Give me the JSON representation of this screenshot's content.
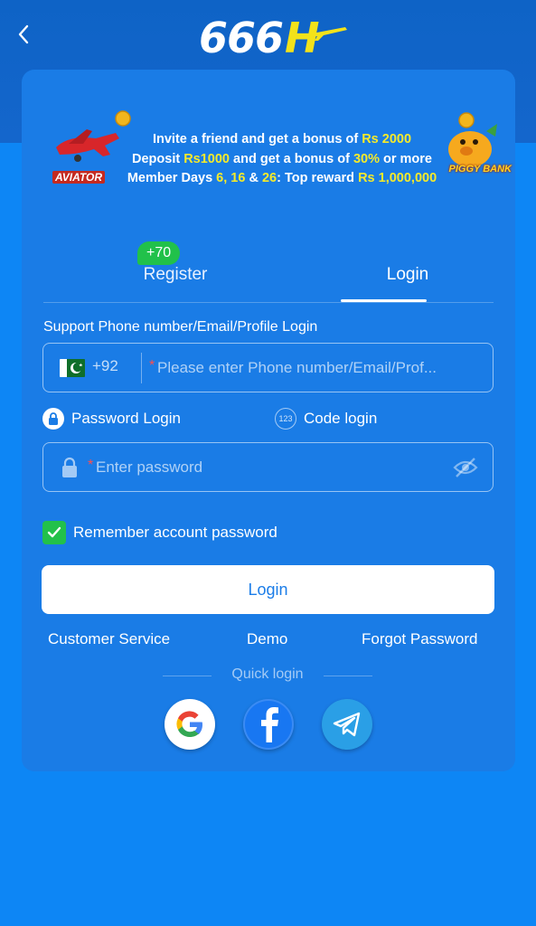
{
  "header": {
    "back_icon": "chevron-left-icon",
    "logo_text": "666",
    "logo_letter": "H"
  },
  "banner": {
    "line1_prefix": "Invite a friend and get a bonus of ",
    "line1_highlight": "Rs 2000",
    "line2_prefix": "Deposit ",
    "line2_highlight1": "Rs1000",
    "line2_mid": " and get a bonus of ",
    "line2_highlight2": "30%",
    "line2_suffix": " or more",
    "line3_prefix": "Member Days ",
    "line3_days1": "6, 16",
    "line3_amp": " & ",
    "line3_days2": "26",
    "line3_mid": ": Top reward ",
    "line3_highlight": "Rs 1,000,000",
    "left_game": "AVIATOR",
    "right_game": "PIGGY BANK"
  },
  "tabs": {
    "register_label": "Register",
    "register_badge": "+70",
    "login_label": "Login",
    "active": "Login"
  },
  "form": {
    "support_label": "Support Phone number/Email/Profile Login",
    "country_code": "+92",
    "country_flag": "pakistan-flag-icon",
    "phone_placeholder": "Please enter Phone number/Email/Prof...",
    "required_mark": "*",
    "password_login_label": "Password Login",
    "code_login_label": "Code login",
    "code_icon_text": "123",
    "password_placeholder": "Enter password",
    "remember_label": "Remember account password",
    "remember_checked": true,
    "login_button": "Login"
  },
  "links": {
    "customer_service": "Customer Service",
    "demo": "Demo",
    "forgot_password": "Forgot Password"
  },
  "quick_login": {
    "label": "Quick login",
    "providers": [
      "google",
      "facebook",
      "telegram"
    ]
  },
  "colors": {
    "background": "#0d86f5",
    "card": "#1a7ce6",
    "accent_yellow": "#f5ea2a",
    "badge_green": "#21c14a",
    "button_text": "#1b7de8"
  }
}
